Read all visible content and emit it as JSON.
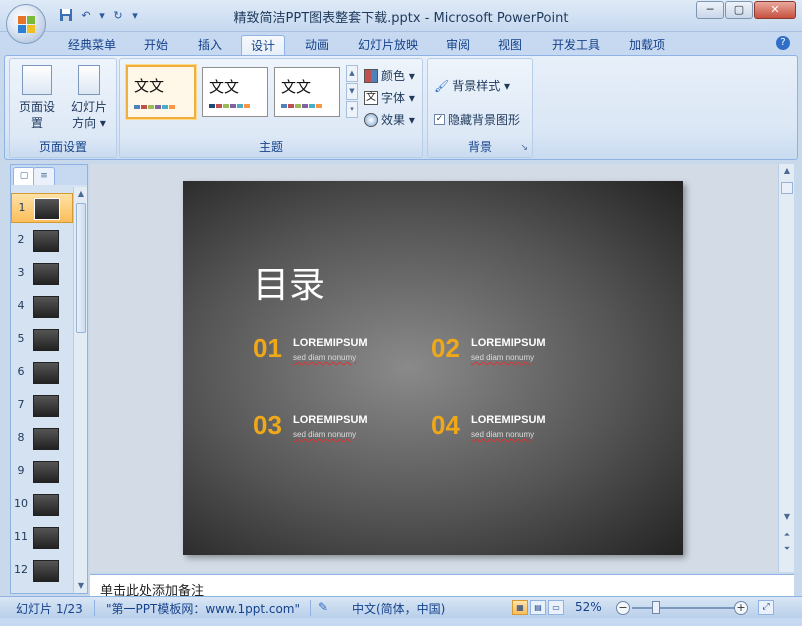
{
  "window": {
    "title": "精致简洁PPT图表整套下载.pptx - Microsoft PowerPoint",
    "minimize": "─",
    "maximize": "▢",
    "close": "✕"
  },
  "qat": {
    "save_icon": "save-icon",
    "undo": "↶",
    "undo_dd": "▾",
    "redo": "↻",
    "customize": "▾"
  },
  "tabs": [
    {
      "label": "经典菜单"
    },
    {
      "label": "开始"
    },
    {
      "label": "插入"
    },
    {
      "label": "设计",
      "active": true
    },
    {
      "label": "动画"
    },
    {
      "label": "幻灯片放映"
    },
    {
      "label": "审阅"
    },
    {
      "label": "视图"
    },
    {
      "label": "开发工具"
    },
    {
      "label": "加载项"
    }
  ],
  "help": "?",
  "ribbon": {
    "page_setup_group": {
      "label": "页面设置",
      "page_setup": "页面设置",
      "orientation_line1": "幻灯片",
      "orientation_line2": "方向 ▾"
    },
    "theme_group": {
      "label": "主题",
      "themes": [
        {
          "text": "文文",
          "selected": true
        },
        {
          "text": "文文",
          "selected": false
        },
        {
          "text": "文文",
          "selected": false
        }
      ],
      "colors": "颜色 ▾",
      "fonts": "字体 ▾",
      "effects": "效果 ▾",
      "swatch_colors": [
        "#4f81bd",
        "#c0504d",
        "#9bbb59",
        "#8064a2",
        "#4bacc6",
        "#f79646"
      ]
    },
    "background_group": {
      "label": "背景",
      "bg_styles": "背景样式 ▾",
      "hide_bg": "隐藏背景图形",
      "hide_bg_checked": true,
      "launcher": "↘"
    }
  },
  "slides_pane": {
    "items": [
      {
        "num": "1",
        "selected": true
      },
      {
        "num": "2"
      },
      {
        "num": "3"
      },
      {
        "num": "4"
      },
      {
        "num": "5"
      },
      {
        "num": "6"
      },
      {
        "num": "7"
      },
      {
        "num": "8"
      },
      {
        "num": "9"
      },
      {
        "num": "10"
      },
      {
        "num": "11"
      },
      {
        "num": "12"
      }
    ]
  },
  "slide": {
    "title": "目录",
    "items": [
      {
        "num": "01",
        "heading": "LOREMIPSUM",
        "sub": "sed diam nonumy"
      },
      {
        "num": "02",
        "heading": "LOREMIPSUM",
        "sub": "sed diam nonumy"
      },
      {
        "num": "03",
        "heading": "LOREMIPSUM",
        "sub": "sed diam nonumy"
      },
      {
        "num": "04",
        "heading": "LOREMIPSUM",
        "sub": "sed diam nonumy"
      }
    ],
    "accent": "#f0a818"
  },
  "notes": {
    "placeholder": "单击此处添加备注"
  },
  "status": {
    "slide_info": "幻灯片 1/23",
    "theme_name": "\"第一PPT模板网：www.1ppt.com\"",
    "language": "中文(简体，中国)",
    "zoom": "52%",
    "zoom_minus": "−",
    "zoom_plus": "+",
    "zoom_level": 52
  }
}
